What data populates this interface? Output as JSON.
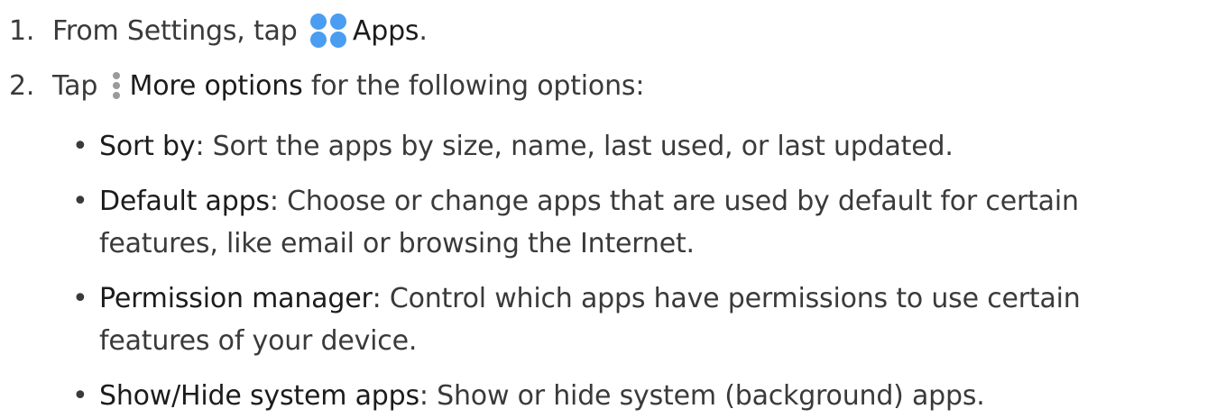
{
  "step1": {
    "number": "1.",
    "text_before": "From Settings, tap",
    "icon": "apps-icon",
    "label": "Apps",
    "text_after": "."
  },
  "step2": {
    "number": "2.",
    "text_before": "Tap",
    "icon": "more-options-icon",
    "label": "More options",
    "text_after": "for the following options:"
  },
  "bullets": [
    {
      "bullet": "•",
      "term": "Sort by",
      "line1": ": Sort the apps by size, name, last used, or last updated.",
      "line2": ""
    },
    {
      "bullet": "•",
      "term": "Default apps",
      "line1": ": Choose or change apps that are used by default for certain",
      "line2": "features, like email or browsing the Internet."
    },
    {
      "bullet": "•",
      "term": "Permission manager",
      "line1": ": Control which apps have permissions to use certain",
      "line2": "features of your device."
    },
    {
      "bullet": "•",
      "term": "Show/Hide system apps",
      "line1": ": Show or hide system (background) apps.",
      "line2": ""
    }
  ],
  "colors": {
    "text": "#3a3a3a",
    "apps_icon_blue": "#4a9df0",
    "more_icon_gray": "#9a9a9a"
  }
}
